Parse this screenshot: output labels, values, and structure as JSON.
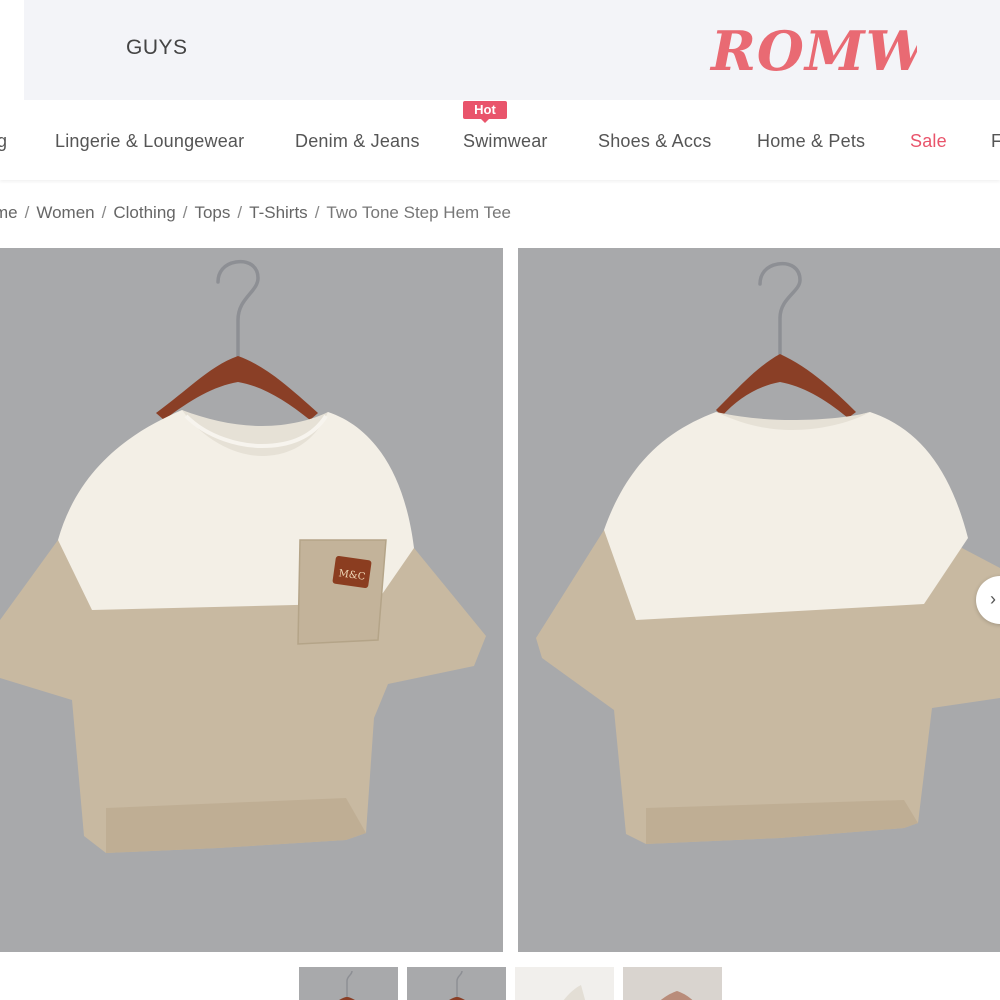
{
  "header": {
    "guys_label": "GUYS",
    "logo_text": "ROMWE",
    "brand_color": "#e96a73"
  },
  "nav": {
    "items": [
      {
        "label": "g"
      },
      {
        "label": "Lingerie & Loungewear"
      },
      {
        "label": "Denim & Jeans"
      },
      {
        "label": "Swimwear"
      },
      {
        "label": "Shoes & Accs"
      },
      {
        "label": "Home & Pets"
      },
      {
        "label": "Sale"
      },
      {
        "label": "F"
      }
    ],
    "hot_badge": "Hot",
    "sale_color": "#e9546b"
  },
  "breadcrumb": {
    "items": [
      "me",
      "Women",
      "Clothing",
      "Tops",
      "T-Shirts"
    ],
    "current": "Two Tone Step Hem Tee",
    "separator": "/"
  },
  "product": {
    "images": [
      {
        "view": "front",
        "pocket_label": "M&C"
      },
      {
        "view": "back"
      }
    ],
    "colors": {
      "top_panel": "#f3efe6",
      "bottom_panel": "#c8b9a1",
      "background": "#a8a9ab",
      "hanger": "#8a3f26"
    }
  },
  "gallery": {
    "next_icon": "chevron-right-icon",
    "next_glyph": "›",
    "thumbnail_count": 4
  }
}
